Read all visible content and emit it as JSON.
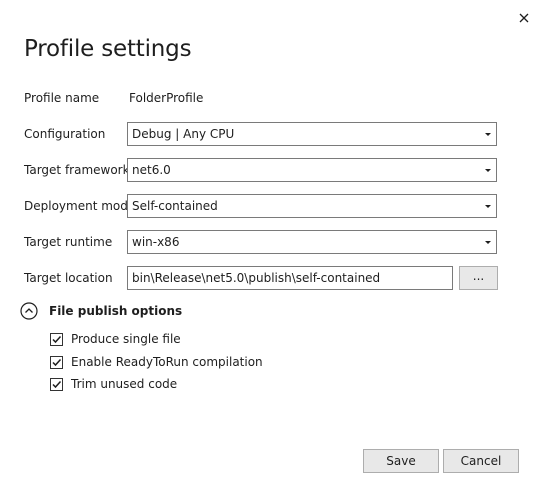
{
  "dialog": {
    "title": "Profile settings",
    "close_icon": "close-icon"
  },
  "fields": {
    "profile_name": {
      "label": "Profile name",
      "value": "FolderProfile"
    },
    "configuration": {
      "label": "Configuration",
      "value": "Debug | Any CPU"
    },
    "target_framework": {
      "label": "Target framework",
      "value": "net6.0"
    },
    "deployment_mode": {
      "label": "Deployment mode",
      "value": "Self-contained"
    },
    "target_runtime": {
      "label": "Target runtime",
      "value": "win-x86"
    },
    "target_location": {
      "label": "Target location",
      "value": "bin\\Release\\net5.0\\publish\\self-contained",
      "browse_label": "..."
    }
  },
  "file_publish_options": {
    "title": "File publish options",
    "expanded": true,
    "options": [
      {
        "label": "Produce single file",
        "checked": true
      },
      {
        "label": "Enable ReadyToRun compilation",
        "checked": true
      },
      {
        "label": "Trim unused code",
        "checked": true
      }
    ]
  },
  "footer": {
    "save_label": "Save",
    "cancel_label": "Cancel"
  }
}
